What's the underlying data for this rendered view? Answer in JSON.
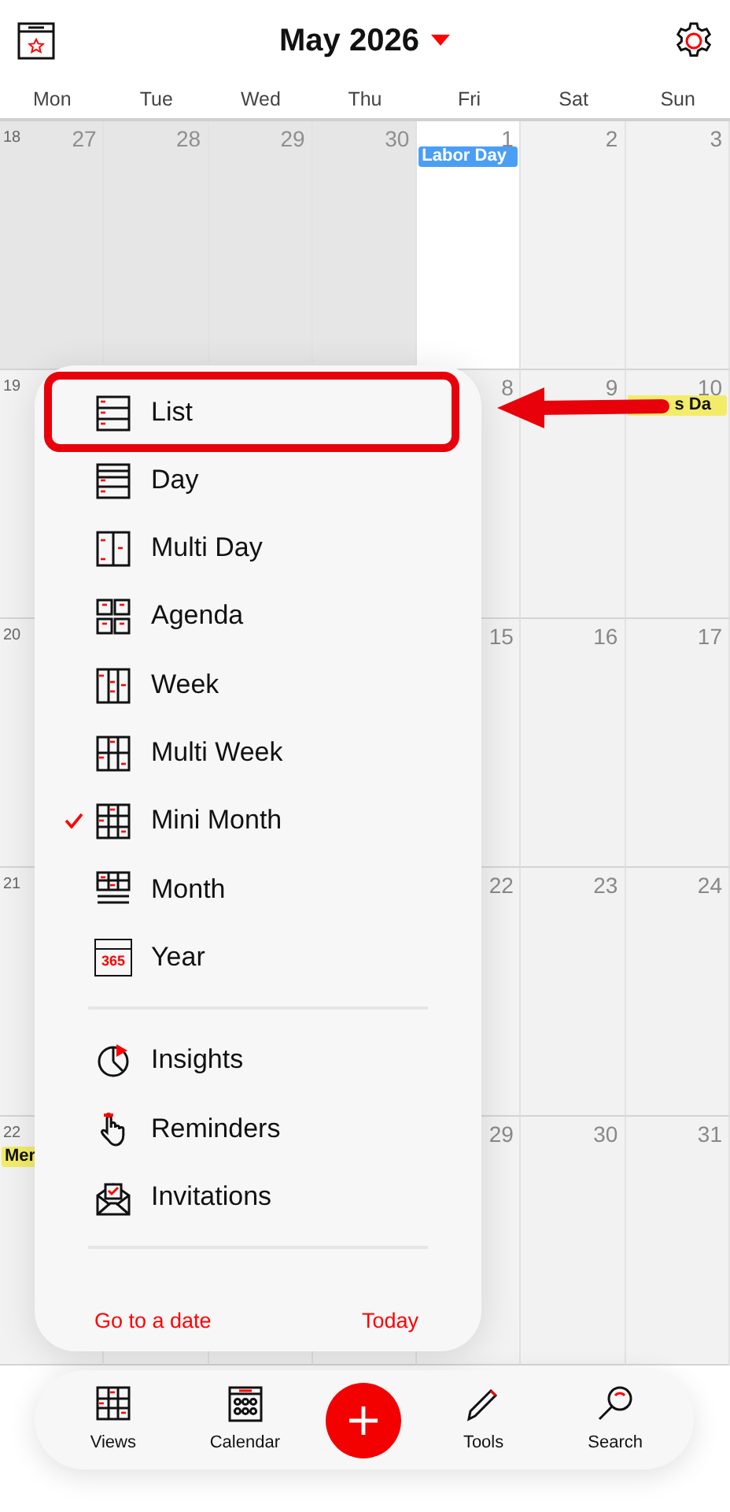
{
  "header": {
    "title": "May 2026"
  },
  "weekdays": [
    "Mon",
    "Tue",
    "Wed",
    "Thu",
    "Fri",
    "Sat",
    "Sun"
  ],
  "weeks": [
    {
      "week": "18",
      "days": [
        {
          "date": "27",
          "in_month": false,
          "selected": false
        },
        {
          "date": "28",
          "in_month": false,
          "selected": false
        },
        {
          "date": "29",
          "in_month": false,
          "selected": false
        },
        {
          "date": "30",
          "in_month": false,
          "selected": false
        },
        {
          "date": "1",
          "in_month": true,
          "selected": true,
          "events": [
            {
              "title": "Labor Day",
              "color": "#4a9ff5",
              "continues": false
            }
          ]
        },
        {
          "date": "2",
          "in_month": true,
          "selected": false
        },
        {
          "date": "3",
          "in_month": true,
          "selected": false
        }
      ]
    },
    {
      "week": "19",
      "monday": {
        "in_month": true,
        "selected": false
      },
      "days": [
        {
          "date": "8",
          "in_month": true,
          "selected": false
        },
        {
          "date": "9",
          "in_month": true,
          "selected": false
        },
        {
          "date": "10",
          "in_month": true,
          "selected": false,
          "events": [
            {
              "title": "s Da",
              "color": "#f3ec6a",
              "continues": true
            }
          ]
        }
      ]
    },
    {
      "week": "20",
      "monday": {
        "in_month": true,
        "selected": false
      },
      "days": [
        {
          "date": "15",
          "in_month": true,
          "selected": false
        },
        {
          "date": "16",
          "in_month": true,
          "selected": false
        },
        {
          "date": "17",
          "in_month": true,
          "selected": false
        }
      ]
    },
    {
      "week": "21",
      "monday": {
        "in_month": true,
        "selected": false
      },
      "days": [
        {
          "date": "22",
          "in_month": true,
          "selected": false
        },
        {
          "date": "23",
          "in_month": true,
          "selected": false
        },
        {
          "date": "24",
          "in_month": true,
          "selected": false
        }
      ]
    },
    {
      "week": "22",
      "monday": {
        "in_month": true,
        "selected": false,
        "events": [
          {
            "title": "Mer",
            "color": "#f3ec6a",
            "continues": false
          }
        ]
      },
      "days": [
        {
          "date": "29",
          "in_month": true,
          "selected": false
        },
        {
          "date": "30",
          "in_month": true,
          "selected": false
        },
        {
          "date": "31",
          "in_month": true,
          "selected": false
        }
      ]
    }
  ],
  "view_menu": {
    "views": [
      {
        "label": "List",
        "kind": "list",
        "checked": false,
        "highlighted": true
      },
      {
        "label": "Day",
        "kind": "day",
        "checked": false,
        "highlighted": false
      },
      {
        "label": "Multi Day",
        "kind": "multiday",
        "checked": false,
        "highlighted": false
      },
      {
        "label": "Agenda",
        "kind": "agenda",
        "checked": false,
        "highlighted": false
      },
      {
        "label": "Week",
        "kind": "week",
        "checked": false,
        "highlighted": false
      },
      {
        "label": "Multi Week",
        "kind": "multiweek",
        "checked": false,
        "highlighted": false
      },
      {
        "label": "Mini Month",
        "kind": "minimonth",
        "checked": true,
        "highlighted": false
      },
      {
        "label": "Month",
        "kind": "month",
        "checked": false,
        "highlighted": false
      },
      {
        "label": "Year",
        "kind": "year",
        "icon_text": "365",
        "checked": false,
        "highlighted": false
      }
    ],
    "tools": [
      {
        "label": "Insights",
        "kind": "insights"
      },
      {
        "label": "Reminders",
        "kind": "reminders"
      },
      {
        "label": "Invitations",
        "kind": "invitations"
      }
    ],
    "footer": [
      {
        "label": "Go to a date"
      },
      {
        "label": "Today"
      }
    ]
  },
  "tabbar": [
    {
      "label": "Views",
      "kind": "views"
    },
    {
      "label": "Calendar",
      "kind": "calendar"
    },
    {
      "kind": "add"
    },
    {
      "label": "Tools",
      "kind": "tools"
    },
    {
      "label": "Search",
      "kind": "search"
    }
  ]
}
